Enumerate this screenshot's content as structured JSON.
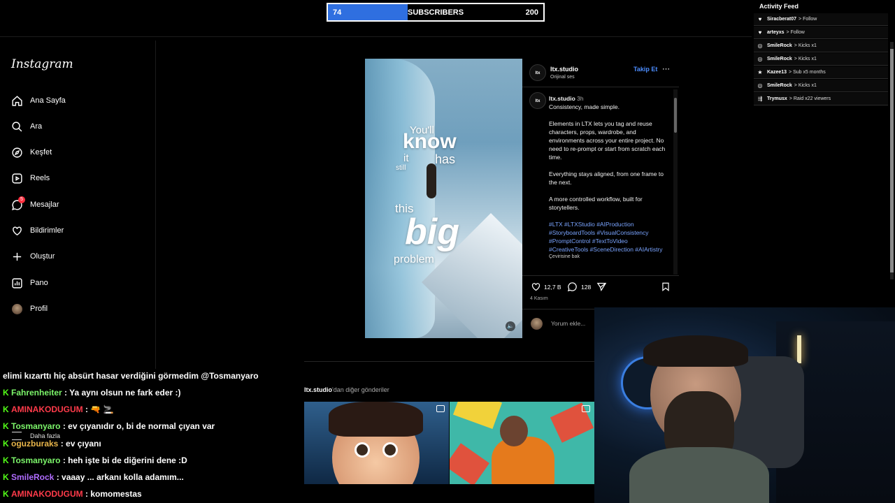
{
  "subscribers": {
    "current": "74",
    "label": "SUBSCRIBERS",
    "goal": "200",
    "progress": 0.37
  },
  "activity_feed": {
    "title": "Activity Feed",
    "items": [
      {
        "icon": "heart-icon",
        "name": "Siracberat07",
        "event": "> Follow"
      },
      {
        "icon": "heart-icon",
        "name": "arteyxs",
        "event": "> Follow"
      },
      {
        "icon": "kick-icon",
        "name": "SmileRock",
        "event": "> Kicks x1"
      },
      {
        "icon": "kick-icon",
        "name": "SmileRock",
        "event": "> Kicks x1"
      },
      {
        "icon": "star-icon",
        "name": "Kazee13",
        "event": "> Sub x5 months"
      },
      {
        "icon": "kick-icon",
        "name": "SmileRock",
        "event": "> Kicks x1"
      },
      {
        "icon": "raid-icon",
        "name": "Trymusx",
        "event": "> Raid x22 viewers"
      }
    ]
  },
  "instagram": {
    "logo": "Instagram",
    "nav": [
      {
        "label": "Ana Sayfa",
        "icon": "home-icon"
      },
      {
        "label": "Ara",
        "icon": "search-icon"
      },
      {
        "label": "Keşfet",
        "icon": "compass-icon"
      },
      {
        "label": "Reels",
        "icon": "reels-icon"
      },
      {
        "label": "Mesajlar",
        "icon": "messenger-icon",
        "badge": "5"
      },
      {
        "label": "Bildirimler",
        "icon": "heart-icon"
      },
      {
        "label": "Oluştur",
        "icon": "plus-icon"
      },
      {
        "label": "Pano",
        "icon": "dashboard-icon"
      },
      {
        "label": "Profil",
        "icon": "avatar"
      }
    ],
    "more": {
      "label": "Daha fazla",
      "icon": "menu-icon"
    },
    "post": {
      "media_text": {
        "l1": "You'll",
        "l2": "know",
        "l3": "it",
        "l4": "has",
        "l5": "still",
        "l6": "this",
        "l7": "big",
        "l8": "problem"
      },
      "account": "ltx.studio",
      "audio": "Orijinal ses",
      "follow": "Takip Et",
      "logo_text": "ltx",
      "time": "3h",
      "caption_title": "Consistency, made simple.",
      "caption_p1": "Elements in LTX lets you tag and reuse characters, props, wardrobe, and environments across your entire project. No need to re-prompt or start from scratch each time.",
      "caption_p2": "Everything stays aligned, from one frame to the next.",
      "caption_p3": "A more controlled workflow, built for storytellers.",
      "hashtags": "#LTX #LTXStudio #AIProduction #StoryboardTools #VisualConsistency #PromptControl #TextToVideo #CreativeTools #SceneDirection #AIArtistry",
      "translate": "Çevirisine bak",
      "likes": "12,7 B",
      "comments": "128",
      "date": "4 Kasım",
      "comment_placeholder": "Yorum ekle..."
    },
    "more_posts": {
      "prefix": "ltx.studio",
      "suffix": "'dan diğer gönderiler"
    }
  },
  "chat": {
    "top_line": "elimi kızarttı hiç absürt hasar verdiğini görmedim @Tosmanyaro",
    "messages": [
      {
        "user": "Fahrenheiter",
        "color": "#7cf56a",
        "text": ": Ya aynı olsun ne fark eder :)"
      },
      {
        "user": "AMINAKODUGUM",
        "color": "#ff3b4a",
        "text": ": 🔫 🚬"
      },
      {
        "user": "Tosmanyaro",
        "color": "#7cf56a",
        "text": ": ev çıyanıdır o, bi de normal çıyan var"
      },
      {
        "user": "oguzburaks",
        "color": "#e8b54a",
        "text": ": ev çıyanı"
      },
      {
        "user": "Tosmanyaro",
        "color": "#7cf56a",
        "text": ": heh işte bi de diğerini dene :D"
      },
      {
        "user": "SmileRock",
        "color": "#b06cff",
        "text": ": vaaay ... arkanı kolla adamım..."
      },
      {
        "user": "AMINAKODUGUM",
        "color": "#ff3b4a",
        "text": ": komomestas"
      }
    ]
  }
}
